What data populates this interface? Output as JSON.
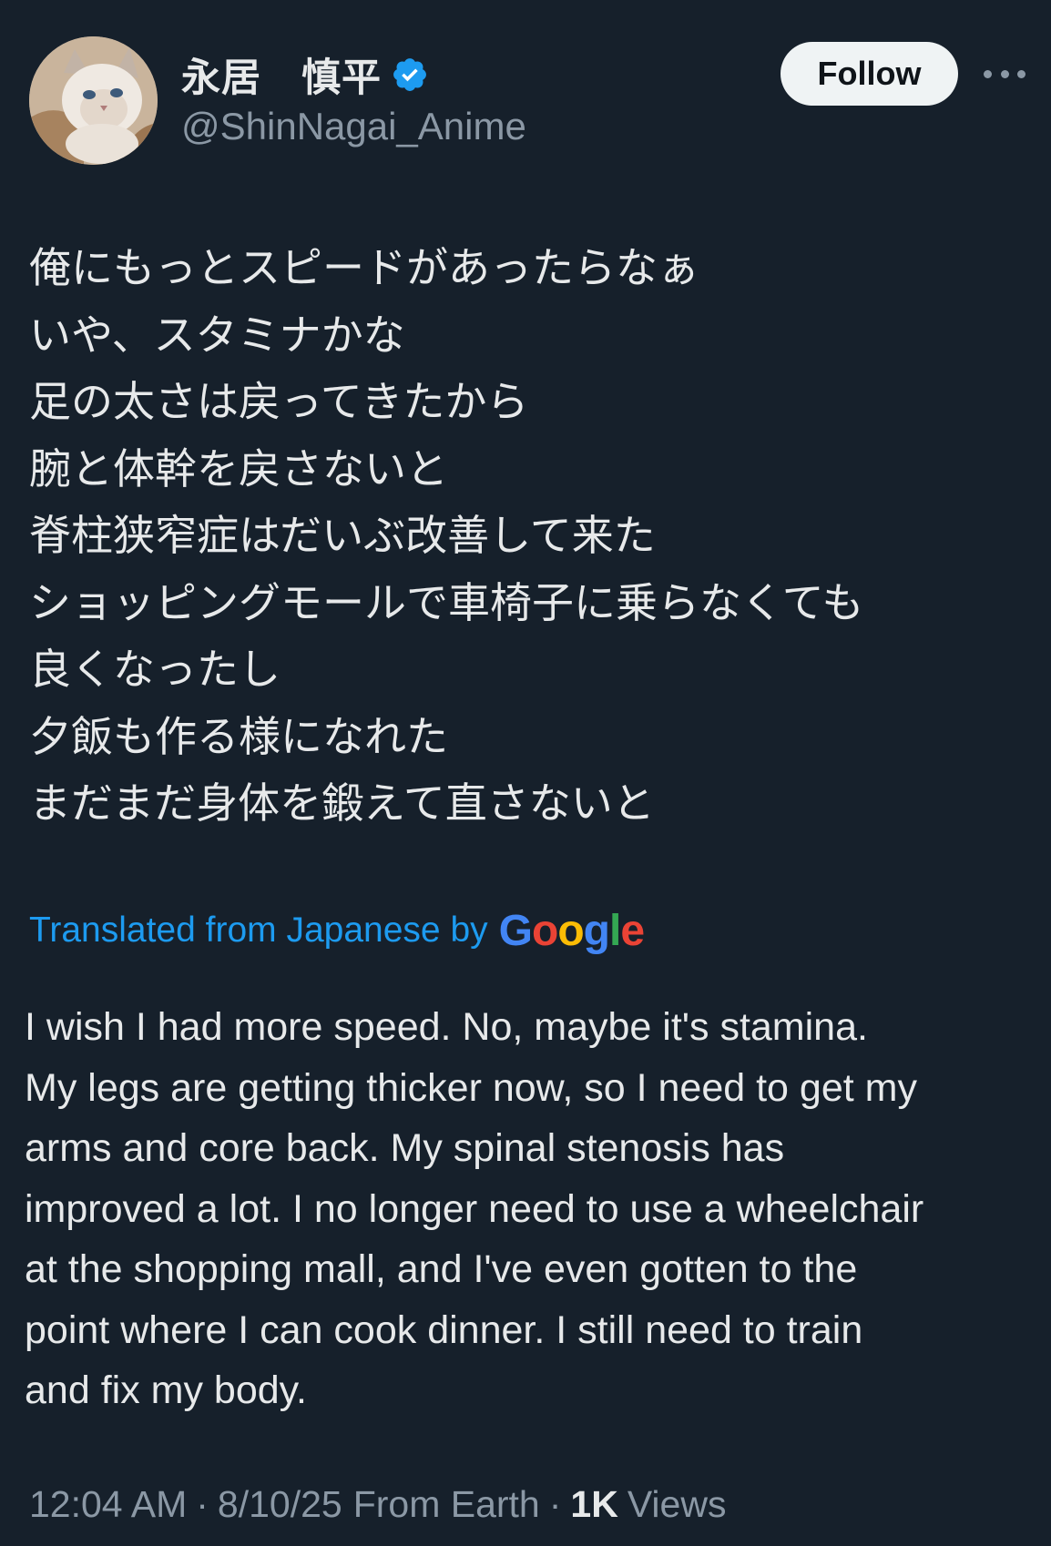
{
  "author": {
    "display_name": "永居　慎平",
    "handle": "@ShinNagai_Anime",
    "verified_icon": "verified-badge-icon",
    "avatar": "cat-avatar-image"
  },
  "actions": {
    "follow_label": "Follow",
    "more_icon": "more-options-icon"
  },
  "post": {
    "original_lines": [
      "俺にもっとスピードがあったらなぁ",
      "いや、スタミナかな",
      "足の太さは戻ってきたから",
      "腕と体幹を戻さないと",
      "脊柱狭窄症はだいぶ改善して来た",
      "ショッピングモールで車椅子に乗らなくても",
      "良くなったし",
      "夕飯も作る様になれた",
      "まだまだ身体を鍛えて直さないと"
    ],
    "translation_label": "Translated from Japanese by",
    "translation_provider": "Google",
    "translated_lines": [
      "I wish I had more speed. No, maybe it's stamina.",
      "My legs are getting thicker now, so I need to get my",
      "arms and core back. My spinal stenosis has",
      "improved a lot. I no longer need to use a wheelchair",
      "at the shopping mall, and I've even gotten to the",
      "point where I can cook dinner. I still need to train",
      "and fix my body."
    ]
  },
  "meta": {
    "time": "12:04 AM",
    "separator": "·",
    "date": "8/10/25",
    "location": "From Earth",
    "views_count": "1K",
    "views_label": "Views"
  },
  "colors": {
    "background": "#16202b",
    "text_primary": "#e7e9ea",
    "text_secondary": "#8b98a5",
    "link_blue": "#1d9bf0",
    "verified_blue": "#1d9bf0"
  }
}
